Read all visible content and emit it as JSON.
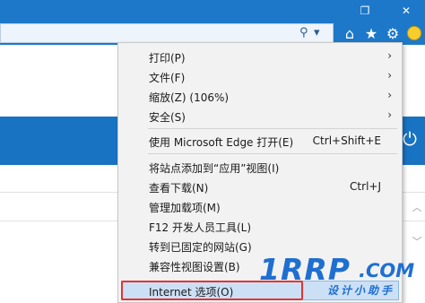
{
  "window_controls": {
    "restore": "❐",
    "close": "✕"
  },
  "address_bar": {
    "search_icon": "⚲",
    "dropdown_icon": "▾"
  },
  "toolbar": {
    "home_icon": "⌂",
    "favorites_icon": "★",
    "tools_icon": "⚙"
  },
  "page": {
    "power_icon": "⏻"
  },
  "menu": {
    "items": [
      {
        "label": "打印(P)",
        "shortcut": "",
        "submenu": true
      },
      {
        "label": "文件(F)",
        "shortcut": "",
        "submenu": true
      },
      {
        "label": "缩放(Z) (106%)",
        "shortcut": "",
        "submenu": true
      },
      {
        "label": "安全(S)",
        "shortcut": "",
        "submenu": true
      },
      {
        "label": "使用 Microsoft Edge 打开(E)",
        "shortcut": "Ctrl+Shift+E",
        "submenu": false
      },
      {
        "label": "将站点添加到“应用”视图(I)",
        "shortcut": "",
        "submenu": false
      },
      {
        "label": "查看下载(N)",
        "shortcut": "Ctrl+J",
        "submenu": false
      },
      {
        "label": "管理加载项(M)",
        "shortcut": "",
        "submenu": false
      },
      {
        "label": "F12 开发人员工具(L)",
        "shortcut": "",
        "submenu": false
      },
      {
        "label": "转到已固定的网站(G)",
        "shortcut": "",
        "submenu": false
      },
      {
        "label": "兼容性视图设置(B)",
        "shortcut": "",
        "submenu": false
      },
      {
        "label": "Internet 选项(O)",
        "shortcut": "",
        "submenu": false,
        "highlighted": true
      }
    ],
    "arrow_glyph": "›"
  },
  "watermark": {
    "main": "1RRP",
    "com": ".COM",
    "sub": "设计小助手"
  },
  "colors": {
    "chrome_blue": "#1d78c9",
    "menu_bg": "#f2f2f2",
    "highlight": "#cce0f5",
    "callout_red": "#e53333",
    "watermark_blue": "#1f6fd1"
  }
}
